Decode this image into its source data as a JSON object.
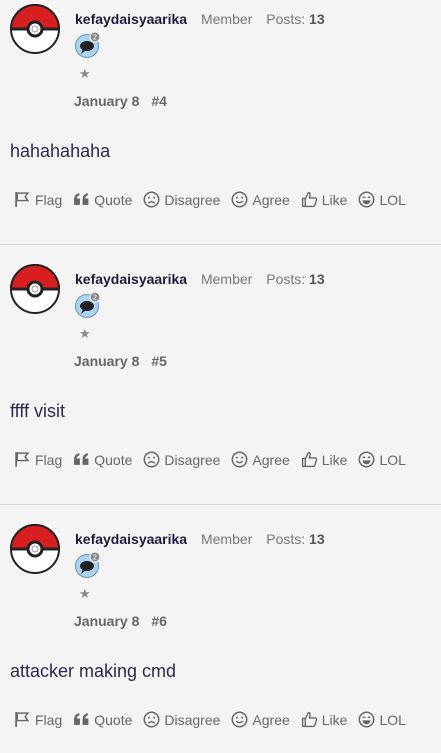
{
  "posts": [
    {
      "username": "kefaydaisyaarika",
      "user_title": "Member",
      "posts_label": "Posts:",
      "posts_count": "13",
      "badge_count": "2",
      "date": "January 8",
      "post_number": "#4",
      "content": "hahahahaha"
    },
    {
      "username": "kefaydaisyaarika",
      "user_title": "Member",
      "posts_label": "Posts:",
      "posts_count": "13",
      "badge_count": "2",
      "date": "January 8",
      "post_number": "#5",
      "content": "ffff visit"
    },
    {
      "username": "kefaydaisyaarika",
      "user_title": "Member",
      "posts_label": "Posts:",
      "posts_count": "13",
      "badge_count": "2",
      "date": "January 8",
      "post_number": "#6",
      "content": "attacker making cmd"
    }
  ],
  "actions": {
    "flag": "Flag",
    "quote": "Quote",
    "disagree": "Disagree",
    "agree": "Agree",
    "like": "Like",
    "lol": "LOL"
  },
  "icons": {
    "avatar": "pokeball-avatar-icon",
    "badge": "speech-bubble-badge-icon",
    "rank": "star-icon",
    "flag": "flag-icon",
    "quote": "quote-icon",
    "disagree": "frown-icon",
    "agree": "smile-icon",
    "like": "thumbs-up-icon",
    "lol": "laugh-icon"
  },
  "colors": {
    "background": "#f4f4f4",
    "username": "#1f1a3d",
    "pokeball_red": "#d81e1e",
    "badge_blue": "#a9d4f5"
  }
}
